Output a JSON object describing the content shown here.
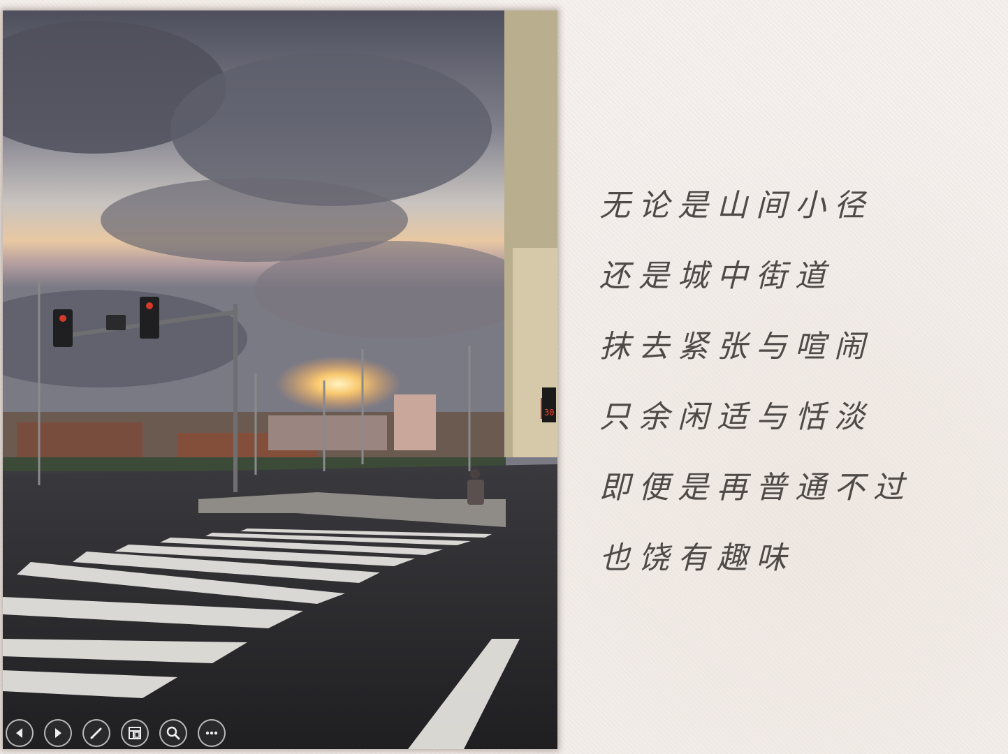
{
  "poem": {
    "lines": [
      "无论是山间小径",
      "还是城中街道",
      "抹去紧张与喧闹",
      "只余闲适与恬淡",
      "即便是再普通不过",
      "也饶有趣味"
    ]
  },
  "photo": {
    "signal_countdown": "30"
  },
  "controls": [
    {
      "name": "previous-slide-button",
      "icon": "arrow-left-icon"
    },
    {
      "name": "next-slide-button",
      "icon": "arrow-right-icon"
    },
    {
      "name": "pen-tool-button",
      "icon": "pen-icon"
    },
    {
      "name": "slide-sorter-button",
      "icon": "slides-grid-icon"
    },
    {
      "name": "zoom-button",
      "icon": "magnifier-icon"
    },
    {
      "name": "more-options-button",
      "icon": "ellipsis-icon"
    }
  ],
  "colors": {
    "paper": "#f5f1ee",
    "text": "#4e4a48",
    "control_ring": "#ebebeb"
  }
}
